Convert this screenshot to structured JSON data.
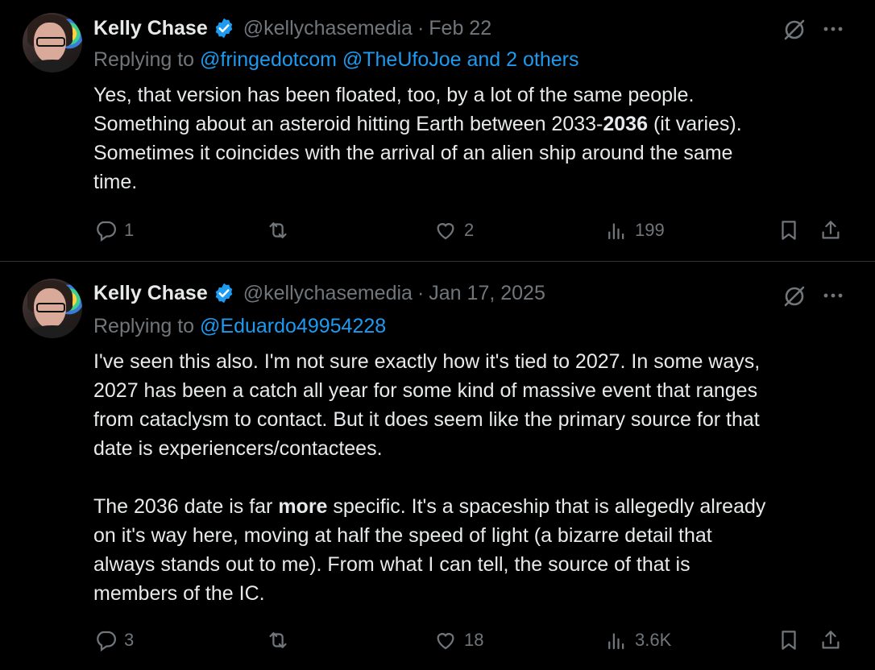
{
  "tweets": [
    {
      "author": {
        "name": "Kelly Chase",
        "handle": "@kellychasemedia"
      },
      "separator": "·",
      "date": "Feb 22",
      "replying_prefix": "Replying to",
      "replying_to": "@fringedotcom @TheUfoJoe and 2 others",
      "body": {
        "line1": "Yes, that version has been floated, too, by a lot of the same people.",
        "line2_a": "Something about an asteroid hitting Earth between 2033-",
        "line2_bold": "2036",
        "line2_b": " (it varies).",
        "line3": "Sometimes it coincides with the arrival of an alien ship around the same",
        "line4": "time."
      },
      "stats": {
        "replies": "1",
        "reposts": "",
        "likes": "2",
        "views": "199"
      }
    },
    {
      "author": {
        "name": "Kelly Chase",
        "handle": "@kellychasemedia"
      },
      "separator": "·",
      "date": "Jan 17, 2025",
      "replying_prefix": "Replying to",
      "replying_to": "@Eduardo49954228",
      "body": {
        "line1": "I've seen this also. I'm not sure exactly how it's tied to 2027. In some ways,",
        "line2": "2027 has been a catch all year for some kind of massive event that ranges",
        "line3": "from cataclysm to contact. But it does seem like the primary source for that",
        "line4": "date is experiencers/contactees.",
        "line5_a": "The 2036 date is far ",
        "line5_bold": "more",
        "line5_b": " specific. It's a spaceship that is allegedly already",
        "line6": "on it's way here, moving at half the speed of light (a bizarre detail that",
        "line7": "always stands out to me). From what I can tell, the source of that is",
        "line8": "members of the IC."
      },
      "stats": {
        "replies": "3",
        "reposts": "",
        "likes": "18",
        "views": "3.6K"
      }
    }
  ],
  "colors": {
    "background": "#000000",
    "text": "#e7e9ea",
    "muted": "#71767b",
    "link": "#1d9bf0",
    "verified": "#1d9bf0",
    "divider": "#2f3336"
  },
  "icons": {
    "verified": "verified-badge-icon",
    "grok": "grok-icon",
    "more": "more-icon",
    "reply": "reply-icon",
    "repost": "repost-icon",
    "like": "like-icon",
    "views": "views-icon",
    "bookmark": "bookmark-icon",
    "share": "share-icon"
  }
}
